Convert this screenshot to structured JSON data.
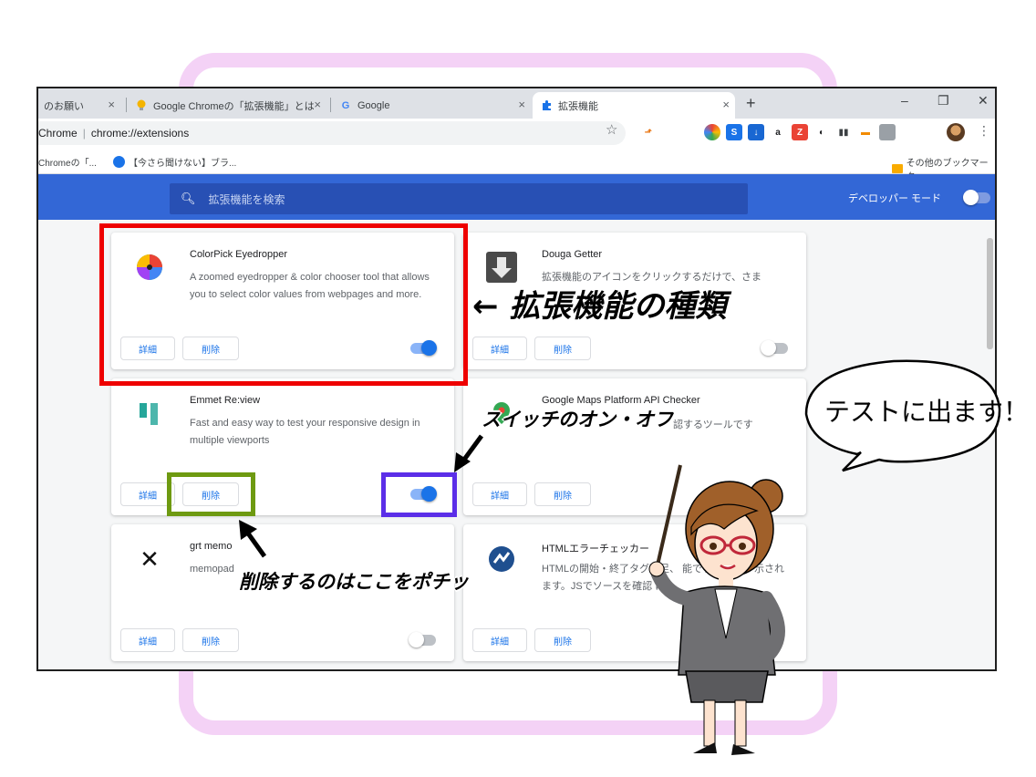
{
  "tabs": [
    {
      "label": "のお願い",
      "icon": "page-icon"
    },
    {
      "label": "Google Chromeの「拡張機能」とは",
      "icon": "lightbulb-icon"
    },
    {
      "label": "Google",
      "icon": "google-icon"
    },
    {
      "label": "拡張機能",
      "icon": "puzzle-icon",
      "active": true
    }
  ],
  "tab_close": "×",
  "new_tab": "+",
  "window_controls": {
    "minimize": "–",
    "maximize": "❐",
    "close": "✕"
  },
  "omnibox": {
    "scheme": "Chrome",
    "url": "chrome://extensions"
  },
  "bookmarks": {
    "item1": "Chromeの「...",
    "item2": "【今さら聞けない】ブラ...",
    "other": "その他のブックマーク"
  },
  "header": {
    "search_placeholder": "拡張機能を検索",
    "dev_mode_label": "デベロッパー モード",
    "dev_mode_on": false
  },
  "buttons": {
    "details": "詳細",
    "remove": "削除"
  },
  "extensions": [
    {
      "name": "ColorPick Eyedropper",
      "desc": "A zoomed eyedropper & color chooser tool that allows you to select color values from webpages and more.",
      "enabled": true,
      "icon": "color-wheel-icon"
    },
    {
      "name": "Douga Getter",
      "desc": "拡張機能のアイコンをクリックするだけで、さま",
      "enabled": false,
      "icon": "download-arrow-icon"
    },
    {
      "name": "Emmet Re:view",
      "desc": "Fast and easy way to test your responsive design in multiple viewports",
      "enabled": true,
      "icon": "emmet-bars-icon"
    },
    {
      "name": "Google Maps Platform API Checker",
      "desc": "認するツールです",
      "enabled": true,
      "icon": "maps-pin-icon"
    },
    {
      "name": "grt memo",
      "desc": "memopad",
      "enabled": false,
      "icon": "memo-x-icon"
    },
    {
      "name": "HTMLエラーチェッカー",
      "desc": "HTMLの開始・終了タグ不足、 能です。エラー 示されます。JSでソースを確認 は",
      "enabled": false,
      "icon": "html-checker-icon"
    }
  ],
  "annotations": {
    "extension_type": "← 拡張機能の種類",
    "switch_on_off": "スイッチのオン・オフ",
    "remove_here": "削除するのはここをポチッ",
    "bubble": "テストに出ます！"
  },
  "colors": {
    "header_blue": "#3367d6",
    "red_box": "#ee0000",
    "green_box": "#6e9a11",
    "purple_box": "#5b2ee8",
    "pink_frame": "#f4d2f6",
    "toggle_on": "#1a73e8"
  }
}
